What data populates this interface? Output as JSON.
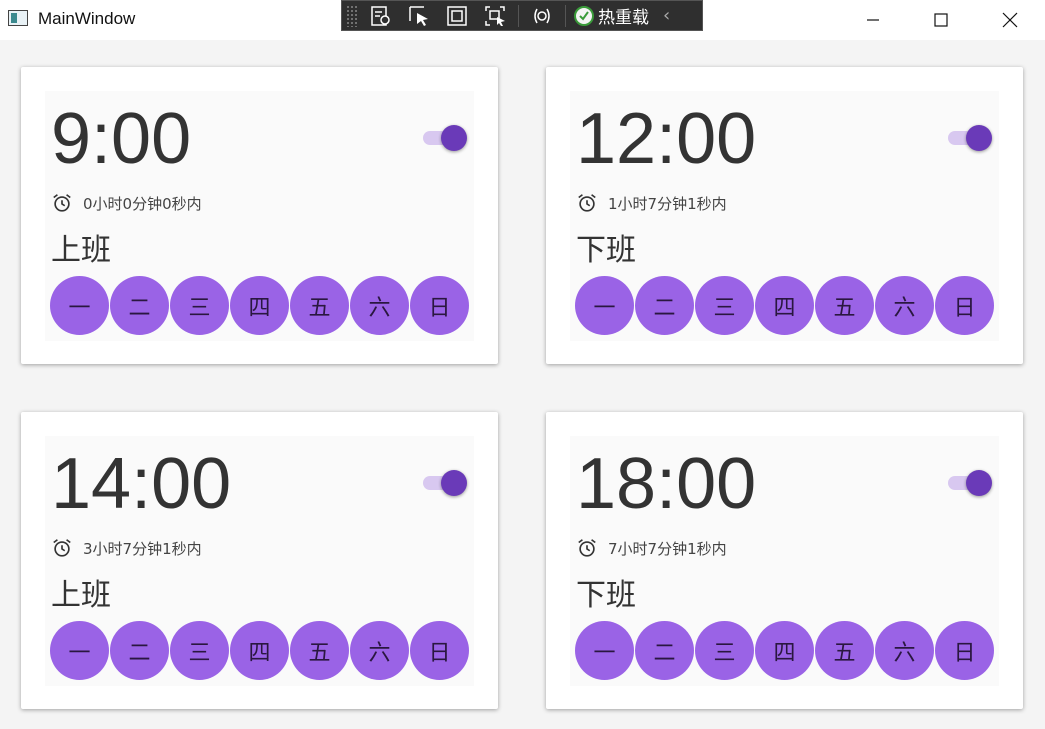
{
  "window": {
    "title": "MainWindow",
    "debug_toolbar": {
      "hot_reload_label": "热重载",
      "collapse_symbol": "‹"
    }
  },
  "alarms": [
    {
      "time": "9:00",
      "enabled": true,
      "countdown": "0小时0分钟0秒内",
      "label": "上班",
      "days": [
        "一",
        "二",
        "三",
        "四",
        "五",
        "六",
        "日"
      ]
    },
    {
      "time": "12:00",
      "enabled": true,
      "countdown": "1小时7分钟1秒内",
      "label": "下班",
      "days": [
        "一",
        "二",
        "三",
        "四",
        "五",
        "六",
        "日"
      ]
    },
    {
      "time": "14:00",
      "enabled": true,
      "countdown": "3小时7分钟1秒内",
      "label": "上班",
      "days": [
        "一",
        "二",
        "三",
        "四",
        "五",
        "六",
        "日"
      ]
    },
    {
      "time": "18:00",
      "enabled": true,
      "countdown": "7小时7分钟1秒内",
      "label": "下班",
      "days": [
        "一",
        "二",
        "三",
        "四",
        "五",
        "六",
        "日"
      ]
    }
  ],
  "colors": {
    "toggle_thumb": "#6a3ab8",
    "toggle_track": "#d8c8f0",
    "day_circle": "#9a63e6",
    "card_background": "#ffffff",
    "card_inner": "#fafafa"
  },
  "icons": {
    "alarm": "alarm-clock-icon",
    "minimize": "minimize-icon",
    "maximize": "maximize-icon",
    "close": "close-icon"
  }
}
